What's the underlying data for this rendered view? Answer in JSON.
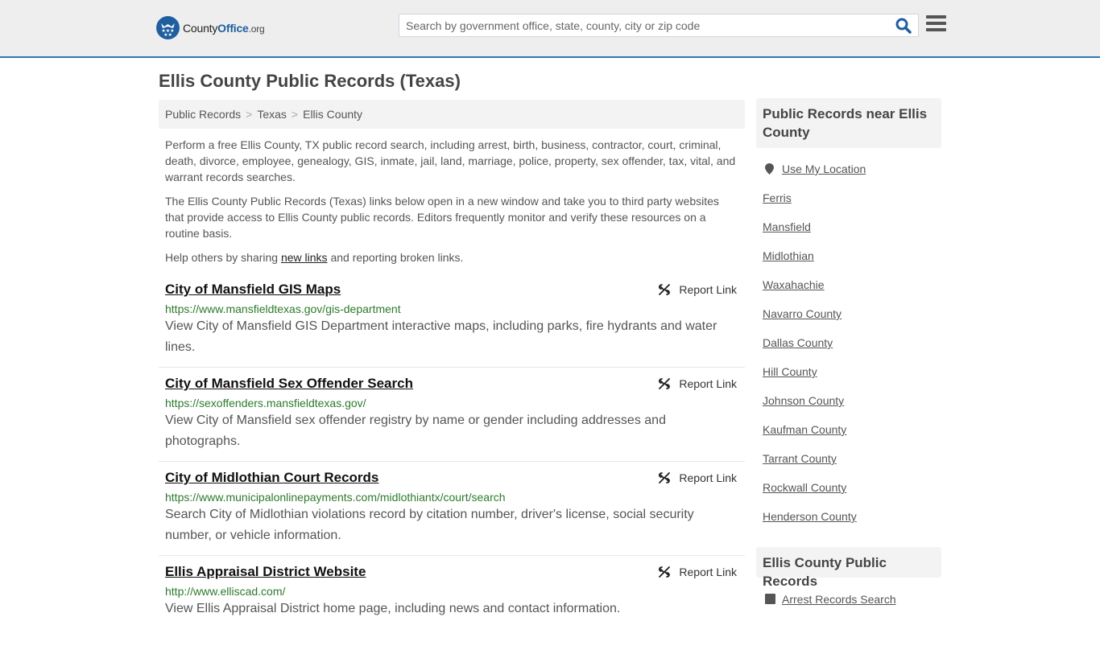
{
  "header": {
    "logo": {
      "name_part1": "County",
      "name_part2": "Office",
      "tld": ".org"
    },
    "search": {
      "placeholder": "Search by government office, state, county, city or zip code",
      "value": ""
    },
    "icons": {
      "search": "search-icon",
      "menu": "hamburger-menu-icon"
    },
    "accent_color": "#2e76b5"
  },
  "page": {
    "title": "Ellis County Public Records (Texas)",
    "breadcrumb": [
      "Public Records",
      "Texas",
      "Ellis County"
    ],
    "intro": [
      "Perform a free Ellis County, TX public record search, including arrest, birth, business, contractor, court, criminal, death, divorce, employee, genealogy, GIS, inmate, jail, land, marriage, police, property, sex offender, tax, vital, and warrant records searches.",
      "The Ellis County Public Records (Texas) links below open in a new window and take you to third party websites that provide access to Ellis County public records. Editors frequently monitor and verify these resources on a routine basis."
    ],
    "help": {
      "before": "Help others by sharing ",
      "link": "new links",
      "after": " and reporting broken links."
    }
  },
  "listings": [
    {
      "title": "City of Mansfield GIS Maps",
      "url": "https://www.mansfieldtexas.gov/gis-department",
      "description": "View City of Mansfield GIS Department interactive maps, including parks, fire hydrants and water lines.",
      "report_label": "Report Link"
    },
    {
      "title": "City of Mansfield Sex Offender Search",
      "url": "https://sexoffenders.mansfieldtexas.gov/",
      "description": "View City of Mansfield sex offender registry by name or gender including addresses and photographs.",
      "report_label": "Report Link"
    },
    {
      "title": "City of Midlothian Court Records",
      "url": "https://www.municipalonlinepayments.com/midlothiantx/court/search",
      "description": "Search City of Midlothian violations record by citation number, driver's license, social security number, or vehicle information.",
      "report_label": "Report Link"
    },
    {
      "title": "Ellis Appraisal District Website",
      "url": "http://www.elliscad.com/",
      "description": "View Ellis Appraisal District home page, including news and contact information.",
      "report_label": "Report Link"
    }
  ],
  "sidebar": {
    "nearby_heading": "Public Records near Ellis County",
    "use_location": "Use My Location",
    "nearby": [
      "Ferris",
      "Mansfield",
      "Midlothian",
      "Waxahachie",
      "Navarro County",
      "Dallas County",
      "Hill County",
      "Johnson County",
      "Kaufman County",
      "Tarrant County",
      "Rockwall County",
      "Henderson County"
    ],
    "records_heading": "Ellis County Public Records",
    "records": [
      "Arrest Records Search"
    ]
  }
}
